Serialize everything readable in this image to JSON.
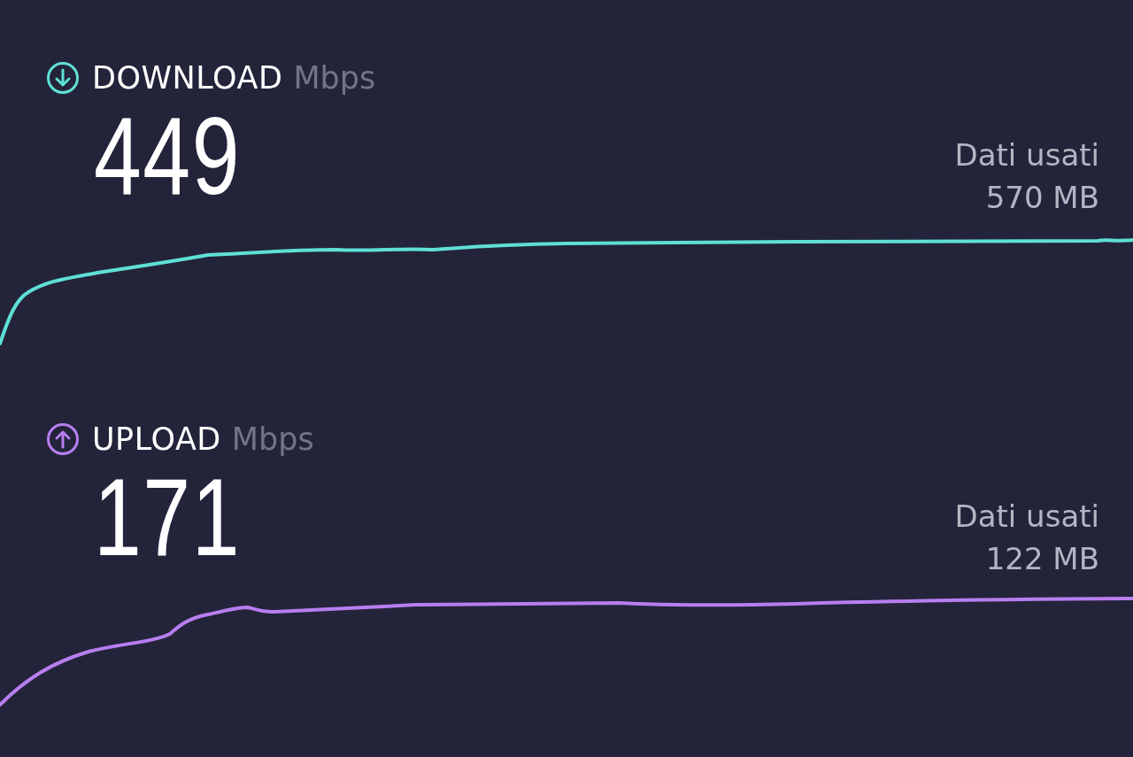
{
  "metrics": [
    {
      "kind": "download",
      "title": "DOWNLOAD",
      "unit": "Mbps",
      "value": "449",
      "data_label": "Dati usati",
      "data_amount": "570 MB",
      "color": "#5fe0d6"
    },
    {
      "kind": "upload",
      "title": "UPLOAD",
      "unit": "Mbps",
      "value": "171",
      "data_label": "Dati usati",
      "data_amount": "122 MB",
      "color": "#b87ef0"
    }
  ]
}
